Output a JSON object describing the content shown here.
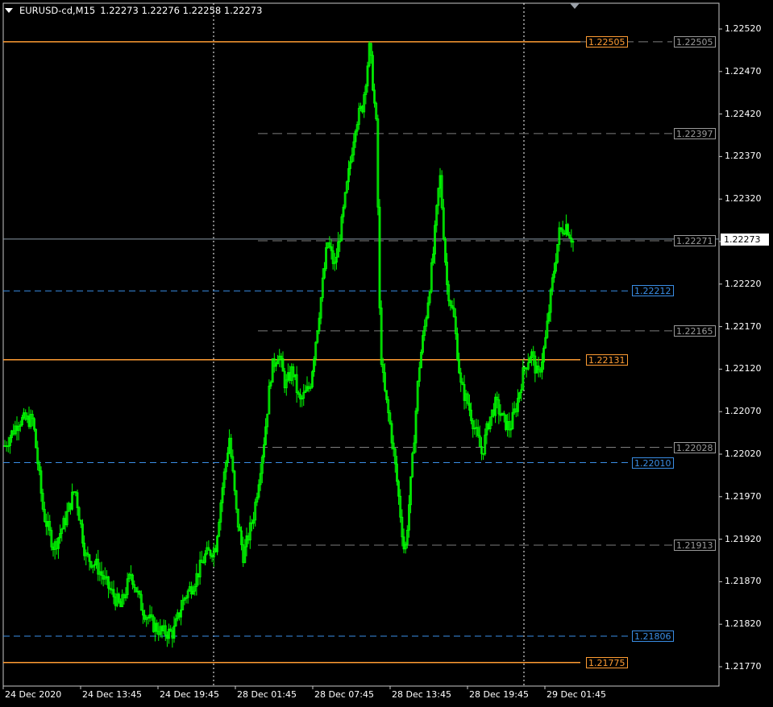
{
  "header": {
    "symbol": "EURUSD-cd,M15",
    "ohlc": "1.22273 1.22276 1.22258 1.22273"
  },
  "price_axis": {
    "ticks": [
      "1.22520",
      "1.22470",
      "1.22420",
      "1.22370",
      "1.22320",
      "1.22270",
      "1.22220",
      "1.22170",
      "1.22120",
      "1.22070",
      "1.22020",
      "1.21970",
      "1.21920",
      "1.21870",
      "1.21820",
      "1.21770"
    ],
    "current_price": "1.22273"
  },
  "time_axis": {
    "ticks": [
      "24 Dec 2020",
      "24 Dec 13:45",
      "24 Dec 19:45",
      "28 Dec 01:45",
      "28 Dec 07:45",
      "28 Dec 13:45",
      "28 Dec 19:45",
      "29 Dec 01:45"
    ]
  },
  "levels": {
    "orange": [
      "1.22505",
      "1.22131",
      "1.21775"
    ],
    "blue": [
      "1.22212",
      "1.22010",
      "1.21806"
    ],
    "gray": [
      "1.22505",
      "1.22397",
      "1.22271",
      "1.22165",
      "1.22028",
      "1.21913"
    ]
  },
  "colors": {
    "candle": "#00ff00",
    "orange_level": "#ff9c33",
    "blue_level": "#3a8ee6",
    "gray_level": "#7d7d7d",
    "separator": "#ffffff",
    "bid_line": "#8a9aa8"
  },
  "chart_data": {
    "type": "line",
    "title": "EURUSD-cd,M15",
    "ylim": [
      1.21745,
      1.22545
    ],
    "x": [
      "24 Dec 2020",
      "24 Dec 13:45",
      "24 Dec 19:45",
      "28 Dec 01:45",
      "28 Dec 07:45",
      "28 Dec 13:45",
      "28 Dec 19:45",
      "29 Dec 01:45"
    ],
    "path": [
      [
        0.0,
        1.2203
      ],
      [
        0.02,
        1.2206
      ],
      [
        0.04,
        1.2206
      ],
      [
        0.055,
        1.2195
      ],
      [
        0.07,
        1.2191
      ],
      [
        0.085,
        1.2194
      ],
      [
        0.1,
        1.2198
      ],
      [
        0.115,
        1.219
      ],
      [
        0.13,
        1.2189
      ],
      [
        0.15,
        1.2186
      ],
      [
        0.165,
        1.2184
      ],
      [
        0.18,
        1.2188
      ],
      [
        0.195,
        1.2184
      ],
      [
        0.21,
        1.2182
      ],
      [
        0.225,
        1.2181
      ],
      [
        0.24,
        1.2181
      ],
      [
        0.255,
        1.2185
      ],
      [
        0.27,
        1.2187
      ],
      [
        0.285,
        1.219
      ],
      [
        0.3,
        1.2191
      ],
      [
        0.31,
        1.2198
      ],
      [
        0.32,
        1.2204
      ],
      [
        0.33,
        1.2195
      ],
      [
        0.34,
        1.219
      ],
      [
        0.355,
        1.2195
      ],
      [
        0.37,
        1.2204
      ],
      [
        0.38,
        1.2212
      ],
      [
        0.39,
        1.2214
      ],
      [
        0.4,
        1.221
      ],
      [
        0.41,
        1.2212
      ],
      [
        0.42,
        1.2208
      ],
      [
        0.435,
        1.221
      ],
      [
        0.45,
        1.222
      ],
      [
        0.46,
        1.2227
      ],
      [
        0.47,
        1.2224
      ],
      [
        0.48,
        1.2229
      ],
      [
        0.49,
        1.2235
      ],
      [
        0.5,
        1.2241
      ],
      [
        0.51,
        1.2243
      ],
      [
        0.52,
        1.225
      ],
      [
        0.53,
        1.224
      ],
      [
        0.535,
        1.2215
      ],
      [
        0.54,
        1.221
      ],
      [
        0.55,
        1.2205
      ],
      [
        0.56,
        1.2198
      ],
      [
        0.57,
        1.219
      ],
      [
        0.58,
        1.22
      ],
      [
        0.59,
        1.2212
      ],
      [
        0.6,
        1.2218
      ],
      [
        0.61,
        1.2225
      ],
      [
        0.62,
        1.2235
      ],
      [
        0.63,
        1.2222
      ],
      [
        0.64,
        1.2218
      ],
      [
        0.65,
        1.221
      ],
      [
        0.66,
        1.2208
      ],
      [
        0.67,
        1.2205
      ],
      [
        0.68,
        1.2202
      ],
      [
        0.69,
        1.2206
      ],
      [
        0.7,
        1.2208
      ],
      [
        0.71,
        1.2206
      ],
      [
        0.72,
        1.2205
      ],
      [
        0.73,
        1.2208
      ],
      [
        0.74,
        1.2212
      ],
      [
        0.75,
        1.2214
      ],
      [
        0.76,
        1.2211
      ],
      [
        0.77,
        1.2215
      ],
      [
        0.78,
        1.2222
      ],
      [
        0.79,
        1.2228
      ],
      [
        0.8,
        1.2229
      ],
      [
        0.81,
        1.2227
      ]
    ]
  }
}
